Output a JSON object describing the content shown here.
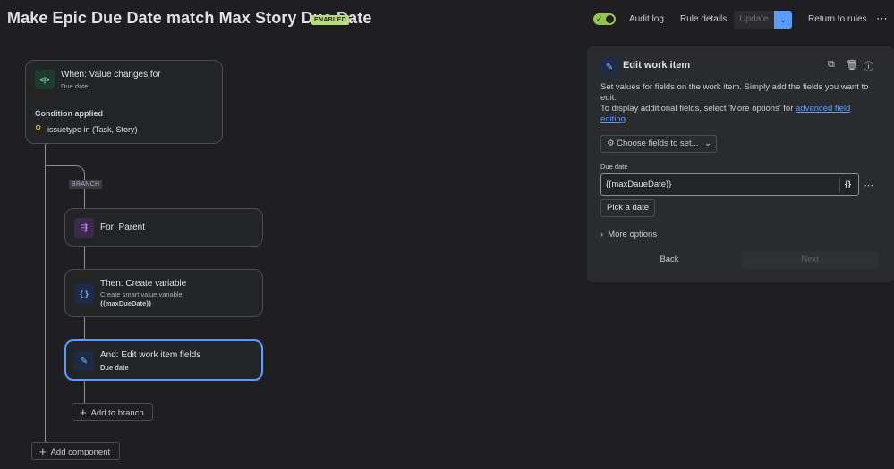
{
  "header": {
    "title": "Make Epic Due Date match Max Story Due Date",
    "status_badge": "ENABLED",
    "audit_log": "Audit log",
    "rule_details": "Rule details",
    "update": "Update",
    "return_to_rules": "Return to rules",
    "more": "⋯"
  },
  "flow": {
    "trigger": {
      "title": "When: Value changes for",
      "subtitle": "Due date",
      "condition_label": "Condition applied",
      "condition_text": "issuetype in (Task, Story)"
    },
    "branch_tag": "BRANCH",
    "for_card": {
      "title": "For: Parent"
    },
    "variable_card": {
      "title": "Then: Create variable",
      "subtitle": "Create smart value variable",
      "value": "{{maxDueDate}}"
    },
    "edit_card": {
      "title": "And: Edit work item fields",
      "subtitle": "Due date"
    },
    "add_to_branch": "Add to branch",
    "add_component": "Add component"
  },
  "panel": {
    "title": "Edit work item",
    "description_1": "Set values for fields on the work item. Simply add the fields you want to edit.",
    "description_2_prefix": "To display additional fields, select 'More options' for ",
    "description_2_link": "advanced field editing",
    "description_2_suffix": ".",
    "choose_fields": "Choose fields to set...",
    "due_date_label": "Due date",
    "due_date_value": "{{maxDaueDate}}",
    "brace_button": "{}",
    "pick_date": "Pick a date",
    "more_options": "More options",
    "back": "Back",
    "next": "Next"
  },
  "colors": {
    "accent": "#579dff",
    "enabled": "#94c748",
    "background": "#1f1f21"
  }
}
